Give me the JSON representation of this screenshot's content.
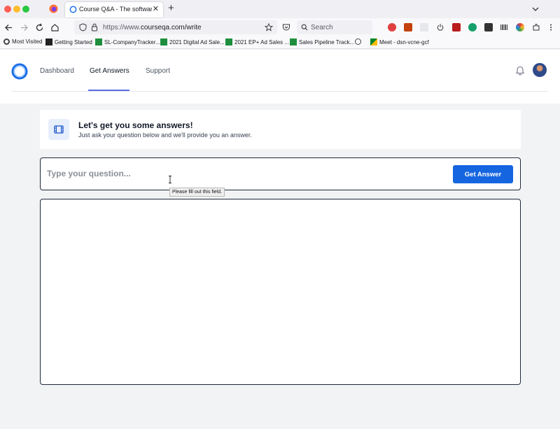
{
  "browser": {
    "tab_title": "Course Q&A - The software buil",
    "url_prefix": "https://www.",
    "url_domain": "courseqa.com/write",
    "search_placeholder": "Search",
    "bookmarks": [
      {
        "label": "Most Visited",
        "icon": "gear-icon"
      },
      {
        "label": "Getting Started",
        "icon": "mastodon-icon"
      },
      {
        "label": "SL-CompanyTracker...",
        "icon": "sheets-icon"
      },
      {
        "label": "2021 Digital Ad Sale...",
        "icon": "sheets-icon"
      },
      {
        "label": "2021 EP+ Ad Sales ...",
        "icon": "sheets-icon"
      },
      {
        "label": "Sales Pipeline Track...",
        "icon": "sheets-icon"
      },
      {
        "label": "",
        "icon": "globe-icon"
      },
      {
        "label": "Meet - dsn-vcne-gcf",
        "icon": "meet-icon"
      }
    ]
  },
  "nav": {
    "items": [
      "Dashboard",
      "Get Answers",
      "Support"
    ],
    "active": "Get Answers"
  },
  "intro": {
    "title": "Let's get you some answers!",
    "subtitle": "Just ask your question below and we'll provide you an answer."
  },
  "question": {
    "placeholder": "Type your question...",
    "button_label": "Get Answer",
    "validation_tooltip": "Please fill out this field."
  },
  "colors": {
    "accent": "#1565e0",
    "nav_underline": "#5b6ee1",
    "border": "#1f2937"
  }
}
